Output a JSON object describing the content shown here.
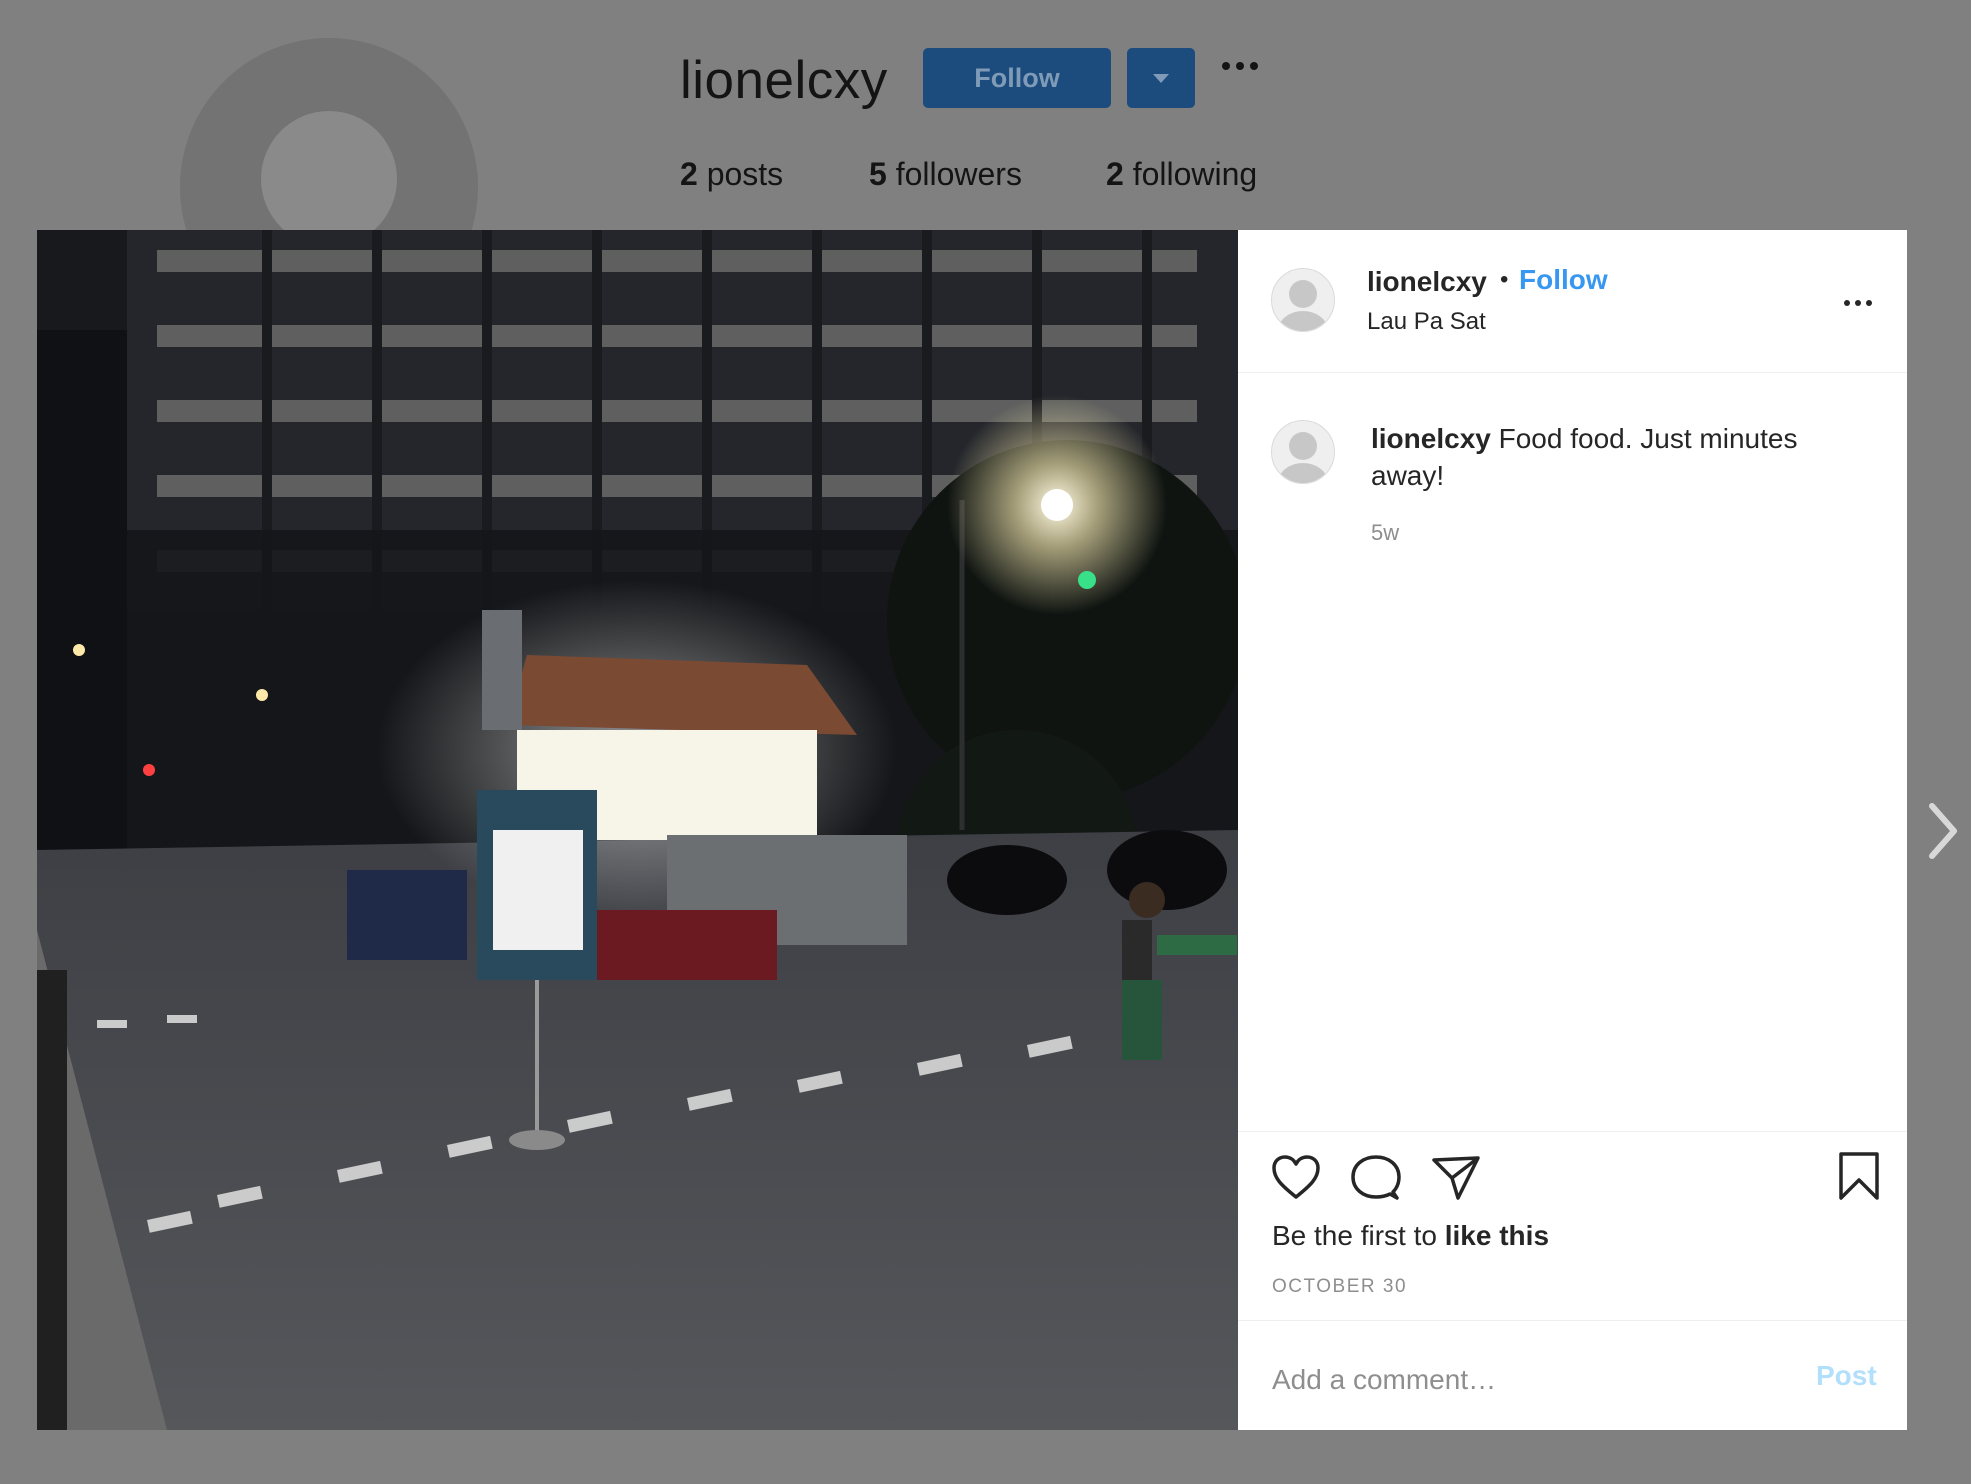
{
  "profile": {
    "username": "lionelcxy",
    "follow_label": "Follow",
    "stats": [
      {
        "count": "2",
        "label": "posts"
      },
      {
        "count": "5",
        "label": "followers"
      },
      {
        "count": "2",
        "label": "following"
      }
    ]
  },
  "post": {
    "username": "lionelcxy",
    "separator": "•",
    "follow_label": "Follow",
    "location": "Lau Pa Sat",
    "caption": {
      "username": "lionelcxy",
      "text": "Food food. Just minutes away!",
      "time": "5w"
    },
    "likes": {
      "prefix": "Be the first to ",
      "action": "like this"
    },
    "date": "OCTOBER 30",
    "comment": {
      "placeholder": "Add a comment…",
      "value": "",
      "post_label": "Post"
    },
    "photo_icon": "night-street-food-stall-photo"
  },
  "colors": {
    "overlay": "#808080",
    "primary_blue": "#3897f0",
    "disabled_blue": "#b2dffc",
    "text": "#262626",
    "secondary_text": "#8e8e8e"
  }
}
